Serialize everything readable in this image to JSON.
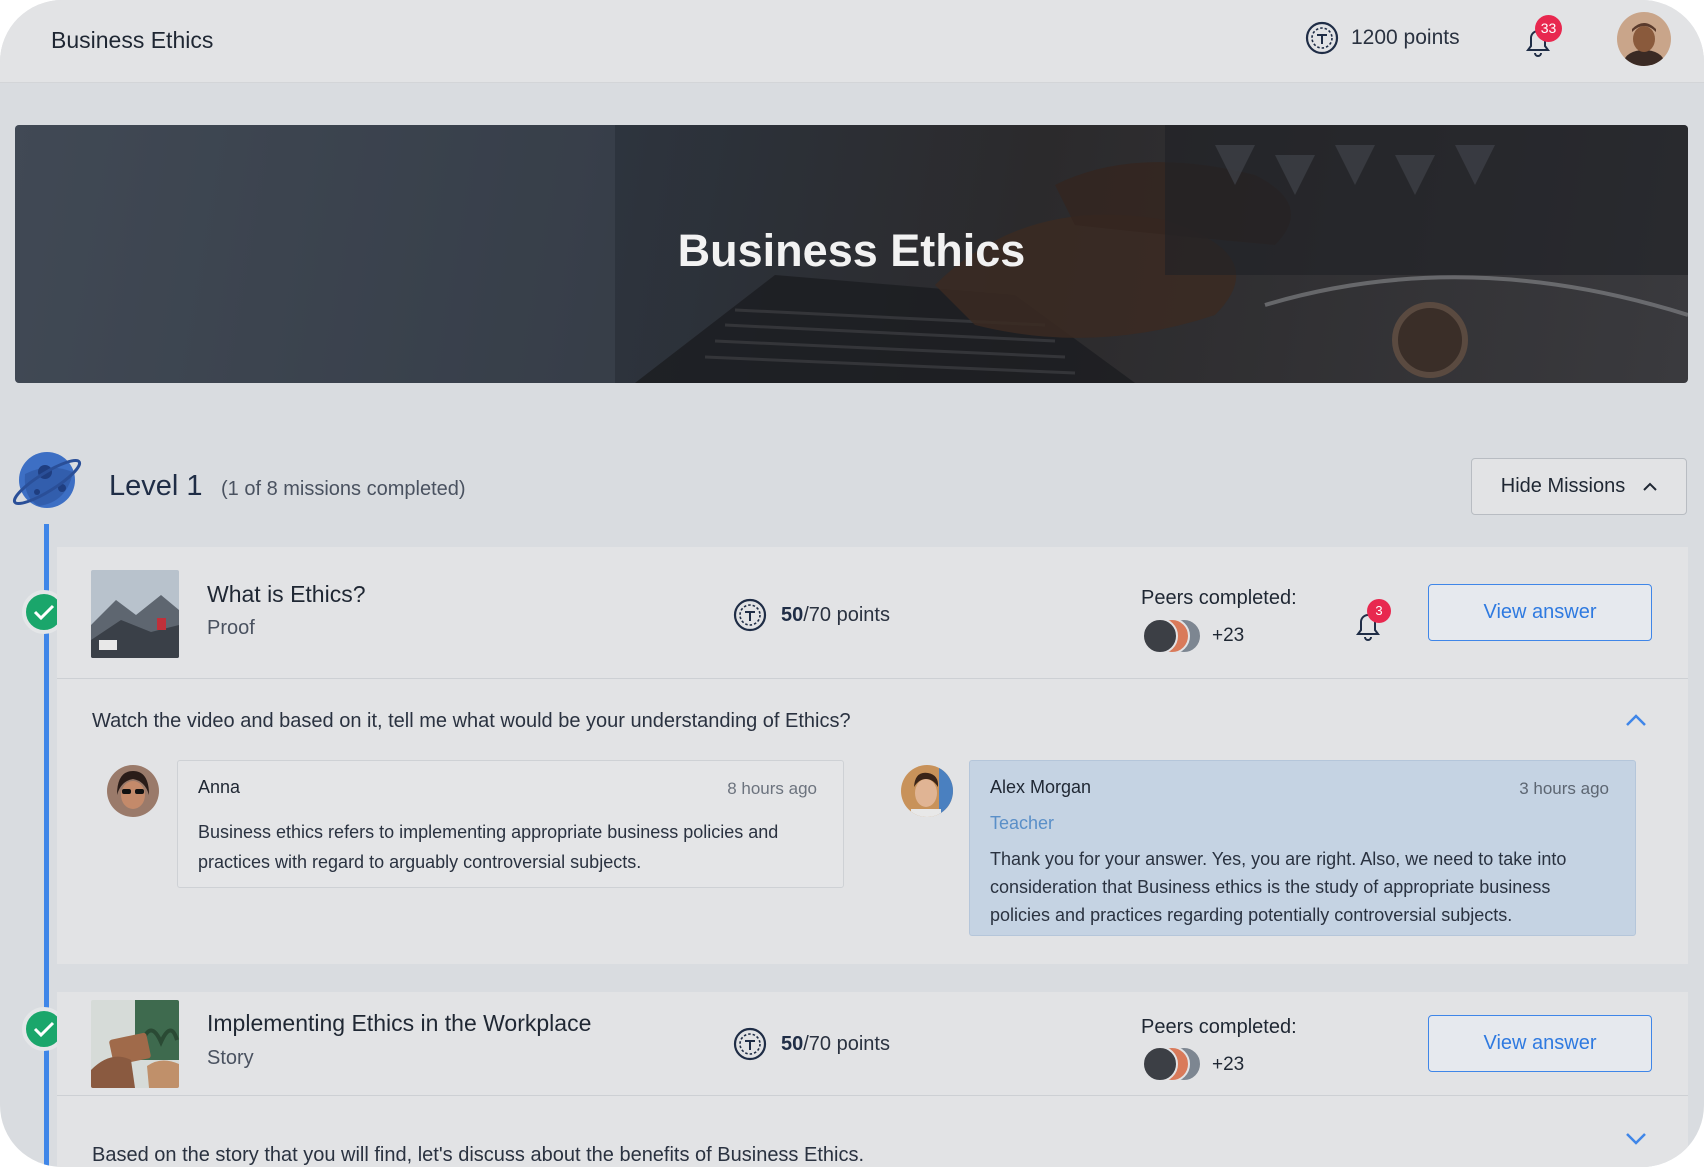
{
  "app": {
    "title": "Business Ethics"
  },
  "header": {
    "points": "1200 points",
    "notification_count": "33"
  },
  "hero": {
    "title": "Business Ethics"
  },
  "level": {
    "title": "Level 1",
    "subtitle": "(1 of 8 missions completed)",
    "toggle_label": "Hide Missions"
  },
  "missions": [
    {
      "title": "What is Ethics?",
      "type": "Proof",
      "points_earned": "50",
      "points_total": "/70 points",
      "peers_label": "Peers completed:",
      "peers_more": "+23",
      "notification_count": "3",
      "action_label": "View answer",
      "question": "Watch the video and based on it, tell me what would be your understanding of Ethics?",
      "comments": [
        {
          "author": "Anna",
          "time": "8 hours ago",
          "text": "Business ethics refers to implementing appropriate business policies and practices with regard to arguably controversial subjects."
        },
        {
          "author": "Alex Morgan",
          "role": "Teacher",
          "time": "3 hours ago",
          "text": "Thank you for your answer. Yes, you are right. Also, we need to take into consideration that Business ethics is the study of appropriate business policies and practices regarding potentially controversial subjects."
        }
      ]
    },
    {
      "title": "Implementing Ethics in the Workplace",
      "type": "Story",
      "points_earned": "50",
      "points_total": "/70 points",
      "peers_label": "Peers completed:",
      "peers_more": "+23",
      "action_label": "View answer",
      "question": "Based on the story that you will find, let's discuss about the benefits of Business Ethics."
    }
  ],
  "colors": {
    "accent": "#3f86e8",
    "success": "#1aa66b",
    "badge": "#e8284f",
    "teacher_bubble": "#c5d3e3"
  }
}
